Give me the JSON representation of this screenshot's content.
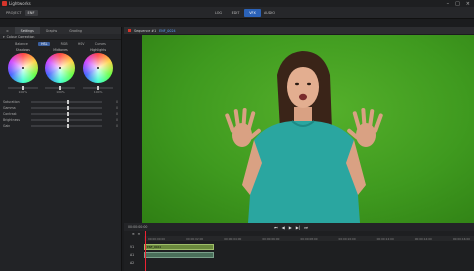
{
  "app": {
    "title": "Lightworks"
  },
  "menubar": {
    "project_label": "PROJECT",
    "project_name": "ENF",
    "tabs": [
      {
        "label": "LOG",
        "active": false
      },
      {
        "label": "EDIT",
        "active": false
      },
      {
        "label": "VFX",
        "active": true
      },
      {
        "label": "AUDIO",
        "active": false
      }
    ]
  },
  "left_panel": {
    "tabs": [
      {
        "label": "≡",
        "active": false
      },
      {
        "label": "Settings",
        "active": true
      },
      {
        "label": "Graphs",
        "active": false
      },
      {
        "label": "Grading",
        "active": false
      }
    ],
    "section_title": "Colour Correction",
    "modes": [
      {
        "label": "Balance",
        "active": false
      },
      {
        "label": "HSL",
        "active": true
      },
      {
        "label": "RGB",
        "active": false
      },
      {
        "label": "HSV",
        "active": false
      },
      {
        "label": "Curves",
        "active": false
      }
    ],
    "wheels": [
      {
        "label": "Shadows",
        "value_left": "0",
        "value_right": "0%",
        "percent": "100%"
      },
      {
        "label": "Midtones",
        "value_left": "0",
        "value_right": "0%",
        "percent": "100%"
      },
      {
        "label": "Highlights",
        "value_left": "0",
        "value_right": "0%",
        "percent": "100%"
      }
    ],
    "properties": [
      {
        "label": "Saturation",
        "value": "0",
        "level": 0.5
      },
      {
        "label": "Gamma",
        "value": "0",
        "level": 0.5
      },
      {
        "label": "Contrast",
        "value": "0",
        "level": 0.5
      },
      {
        "label": "Brightness",
        "value": "0",
        "level": 0.5
      },
      {
        "label": "Gain",
        "value": "0",
        "level": 0.5
      }
    ]
  },
  "viewer": {
    "sequence_label": "Sequence #1",
    "clip_name": "ENF_0024"
  },
  "transport": {
    "timecode": "00:00:00:00"
  },
  "timeline": {
    "ruler_ticks": [
      "00:00:00:00",
      "00:00:02:00",
      "00:00:04:00",
      "00:00:06:00",
      "00:00:08:00",
      "00:00:10:00",
      "00:00:12:00",
      "00:00:14:00",
      "00:00:16:00"
    ],
    "tracks": [
      {
        "name": "V1",
        "clip": "ENF_0024"
      },
      {
        "name": "A1",
        "clip": ""
      },
      {
        "name": "A2",
        "clip": ""
      }
    ]
  }
}
